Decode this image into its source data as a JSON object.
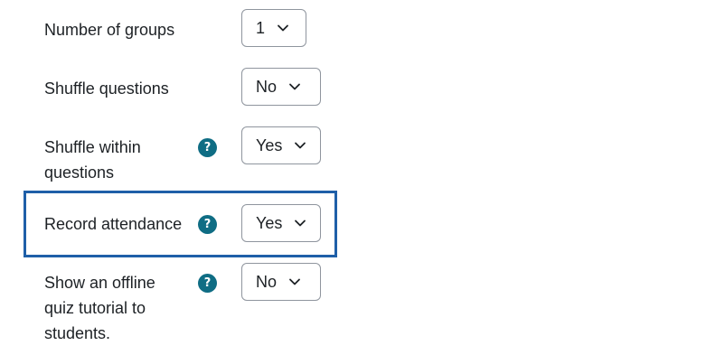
{
  "form": {
    "rows": [
      {
        "label": "Number of groups",
        "value": "1",
        "has_help": false
      },
      {
        "label": "Shuffle questions",
        "value": "No",
        "has_help": false
      },
      {
        "label_lines": [
          "Shuffle within",
          "questions"
        ],
        "value": "Yes",
        "has_help": true
      },
      {
        "label": "Record attendance",
        "value": "Yes",
        "has_help": true
      },
      {
        "label_lines": [
          "Show an offline",
          "quiz tutorial to",
          "students."
        ],
        "value": "No",
        "has_help": true
      }
    ],
    "help_glyph": "?"
  },
  "icons": {
    "help": "question-circle-icon",
    "dropdown": "chevron-down-icon"
  },
  "colors": {
    "help_icon_bg": "#0f6d84",
    "highlight_border": "#1f5fa8",
    "select_border": "#8f959e",
    "text": "#1d2125"
  }
}
